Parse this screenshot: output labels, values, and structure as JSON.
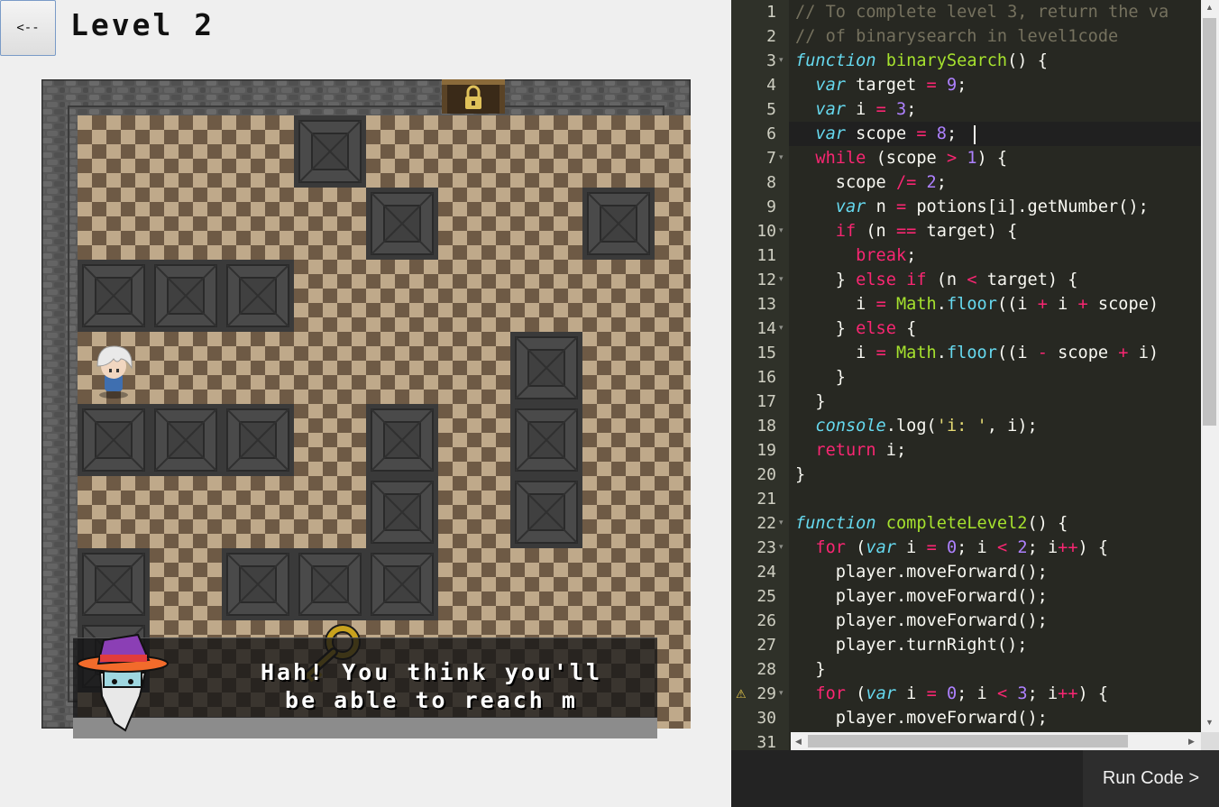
{
  "header": {
    "back_label": "<--",
    "level_title": "Level 2"
  },
  "dialog": {
    "lines": [
      "Hah! You think you'll",
      "be able to reach m"
    ]
  },
  "editor": {
    "line_numbers": [
      "1",
      "2",
      "3",
      "4",
      "5",
      "6",
      "7",
      "8",
      "9",
      "10",
      "11",
      "12",
      "13",
      "14",
      "15",
      "16",
      "17",
      "18",
      "19",
      "20",
      "21",
      "22",
      "23",
      "24",
      "25",
      "26",
      "27",
      "28",
      "29",
      "30",
      "31"
    ],
    "fold_lines": [
      3,
      7,
      10,
      12,
      14,
      22,
      23,
      29
    ],
    "warning_lines": [
      29
    ],
    "active_line": 6,
    "warning_icon": "warning-triangle-icon",
    "code": [
      [
        [
          "c",
          "// To complete level 3, return the va"
        ]
      ],
      [
        [
          "c",
          "// of binarysearch in level1code"
        ]
      ],
      [
        [
          "s",
          "function"
        ],
        [
          "t",
          " "
        ],
        [
          "f",
          "binarySearch"
        ],
        [
          "t",
          "() {"
        ]
      ],
      [
        [
          "t",
          "  "
        ],
        [
          "s",
          "var"
        ],
        [
          "t",
          " target "
        ],
        [
          "k",
          "="
        ],
        [
          "t",
          " "
        ],
        [
          "n",
          "9"
        ],
        [
          "t",
          ";"
        ]
      ],
      [
        [
          "t",
          "  "
        ],
        [
          "s",
          "var"
        ],
        [
          "t",
          " i "
        ],
        [
          "k",
          "="
        ],
        [
          "t",
          " "
        ],
        [
          "n",
          "3"
        ],
        [
          "t",
          ";"
        ]
      ],
      [
        [
          "t",
          "  "
        ],
        [
          "s",
          "var"
        ],
        [
          "t",
          " scope "
        ],
        [
          "k",
          "="
        ],
        [
          "t",
          " "
        ],
        [
          "n",
          "8"
        ],
        [
          "t",
          ";"
        ]
      ],
      [
        [
          "t",
          "  "
        ],
        [
          "k",
          "while"
        ],
        [
          "t",
          " (scope "
        ],
        [
          "k",
          ">"
        ],
        [
          "t",
          " "
        ],
        [
          "n",
          "1"
        ],
        [
          "t",
          ") {"
        ]
      ],
      [
        [
          "t",
          "    scope "
        ],
        [
          "k",
          "/="
        ],
        [
          "t",
          " "
        ],
        [
          "n",
          "2"
        ],
        [
          "t",
          ";"
        ]
      ],
      [
        [
          "t",
          "    "
        ],
        [
          "s",
          "var"
        ],
        [
          "t",
          " n "
        ],
        [
          "k",
          "="
        ],
        [
          "t",
          " potions[i].getNumber();"
        ]
      ],
      [
        [
          "t",
          "    "
        ],
        [
          "k",
          "if"
        ],
        [
          "t",
          " (n "
        ],
        [
          "k",
          "=="
        ],
        [
          "t",
          " target) {"
        ]
      ],
      [
        [
          "t",
          "      "
        ],
        [
          "k",
          "break"
        ],
        [
          "t",
          ";"
        ]
      ],
      [
        [
          "t",
          "    } "
        ],
        [
          "k",
          "else"
        ],
        [
          "t",
          " "
        ],
        [
          "k",
          "if"
        ],
        [
          "t",
          " (n "
        ],
        [
          "k",
          "<"
        ],
        [
          "t",
          " target) {"
        ]
      ],
      [
        [
          "t",
          "      i "
        ],
        [
          "k",
          "="
        ],
        [
          "t",
          " "
        ],
        [
          "y",
          "Math"
        ],
        [
          "t",
          "."
        ],
        [
          "b",
          "floor"
        ],
        [
          "t",
          "((i "
        ],
        [
          "k",
          "+"
        ],
        [
          "t",
          " i "
        ],
        [
          "k",
          "+"
        ],
        [
          "t",
          " scope)"
        ]
      ],
      [
        [
          "t",
          "    } "
        ],
        [
          "k",
          "else"
        ],
        [
          "t",
          " {"
        ]
      ],
      [
        [
          "t",
          "      i "
        ],
        [
          "k",
          "="
        ],
        [
          "t",
          " "
        ],
        [
          "y",
          "Math"
        ],
        [
          "t",
          "."
        ],
        [
          "b",
          "floor"
        ],
        [
          "t",
          "((i "
        ],
        [
          "k",
          "-"
        ],
        [
          "t",
          " scope "
        ],
        [
          "k",
          "+"
        ],
        [
          "t",
          " i)"
        ]
      ],
      [
        [
          "t",
          "    }"
        ]
      ],
      [
        [
          "t",
          "  }"
        ]
      ],
      [
        [
          "t",
          "  "
        ],
        [
          "s",
          "console"
        ],
        [
          "t",
          ".log("
        ],
        [
          "q",
          "'i: '"
        ],
        [
          "t",
          ", i);"
        ]
      ],
      [
        [
          "t",
          "  "
        ],
        [
          "k",
          "return"
        ],
        [
          "t",
          " i;"
        ]
      ],
      [
        [
          "t",
          "}"
        ]
      ],
      [
        [
          "t",
          ""
        ]
      ],
      [
        [
          "s",
          "function"
        ],
        [
          "t",
          " "
        ],
        [
          "f",
          "completeLevel2"
        ],
        [
          "t",
          "() {"
        ]
      ],
      [
        [
          "t",
          "  "
        ],
        [
          "k",
          "for"
        ],
        [
          "t",
          " ("
        ],
        [
          "s",
          "var"
        ],
        [
          "t",
          " i "
        ],
        [
          "k",
          "="
        ],
        [
          "t",
          " "
        ],
        [
          "n",
          "0"
        ],
        [
          "t",
          "; i "
        ],
        [
          "k",
          "<"
        ],
        [
          "t",
          " "
        ],
        [
          "n",
          "2"
        ],
        [
          "t",
          "; i"
        ],
        [
          "k",
          "++"
        ],
        [
          "t",
          ") {"
        ]
      ],
      [
        [
          "t",
          "    player.moveForward();"
        ]
      ],
      [
        [
          "t",
          "    player.moveForward();"
        ]
      ],
      [
        [
          "t",
          "    player.moveForward();"
        ]
      ],
      [
        [
          "t",
          "    player.turnRight();"
        ]
      ],
      [
        [
          "t",
          "  }"
        ]
      ],
      [
        [
          "t",
          "  "
        ],
        [
          "k",
          "for"
        ],
        [
          "t",
          " ("
        ],
        [
          "s",
          "var"
        ],
        [
          "t",
          " i "
        ],
        [
          "k",
          "="
        ],
        [
          "t",
          " "
        ],
        [
          "n",
          "0"
        ],
        [
          "t",
          "; i "
        ],
        [
          "k",
          "<"
        ],
        [
          "t",
          " "
        ],
        [
          "n",
          "3"
        ],
        [
          "t",
          "; i"
        ],
        [
          "k",
          "++"
        ],
        [
          "t",
          ") {"
        ]
      ],
      [
        [
          "t",
          "    player.moveForward();"
        ]
      ],
      [
        [
          "t",
          ""
        ]
      ]
    ]
  },
  "run_button": {
    "label": "Run Code >"
  },
  "board": {
    "cols": 9,
    "rows": 9,
    "walls": [
      [
        3,
        0
      ],
      [
        4,
        1
      ],
      [
        7,
        1
      ],
      [
        0,
        2
      ],
      [
        1,
        2
      ],
      [
        2,
        2
      ],
      [
        6,
        3
      ],
      [
        0,
        4
      ],
      [
        1,
        4
      ],
      [
        2,
        4
      ],
      [
        4,
        4
      ],
      [
        6,
        4
      ],
      [
        4,
        5
      ],
      [
        6,
        5
      ],
      [
        0,
        6
      ],
      [
        2,
        6
      ],
      [
        3,
        6
      ],
      [
        4,
        6
      ],
      [
        0,
        7
      ]
    ],
    "player": [
      0,
      3
    ],
    "door": "locked-door-icon",
    "colors": {
      "floor_light": "#bfa98a",
      "floor_dark": "#6e5a45",
      "wall": "#4a4a4a",
      "border": "#555555",
      "key": "#c9a21d"
    }
  }
}
